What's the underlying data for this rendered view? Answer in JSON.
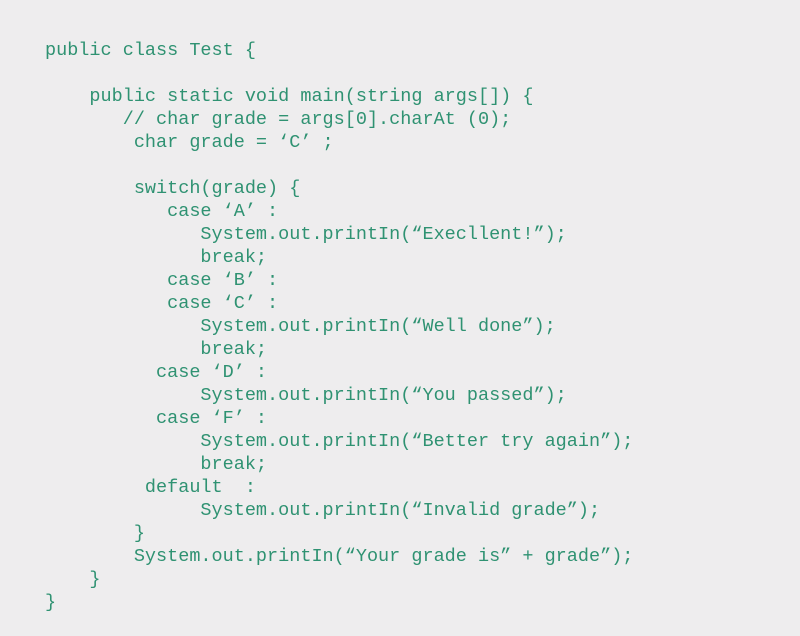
{
  "document": {
    "kind": "source-code-listing",
    "language": "Java",
    "class_name": "Test",
    "background_color": "#eeedee",
    "text_color": "#2f9272",
    "lines": [
      "public class Test {",
      "",
      "    public static void main(string args[]) {",
      "       // char grade = args[0].charAt (0);",
      "        char grade = ‘C’ ;",
      "",
      "        switch(grade) {",
      "           case ‘A’ :",
      "              System.out.printIn(“Execllent!”);",
      "              break;",
      "           case ‘B’ :",
      "           case ‘C’ :",
      "              System.out.printIn(“Well done”);",
      "              break;",
      "          case ‘D’ :",
      "              System.out.printIn(“You passed”);",
      "          case ‘F’ :",
      "              System.out.printIn(“Better try again”);",
      "              break;",
      "         default  :",
      "              System.out.printIn(“Invalid grade”);",
      "        }",
      "        System.out.printIn(“Your grade is” + grade”);",
      "    }",
      "}"
    ]
  }
}
